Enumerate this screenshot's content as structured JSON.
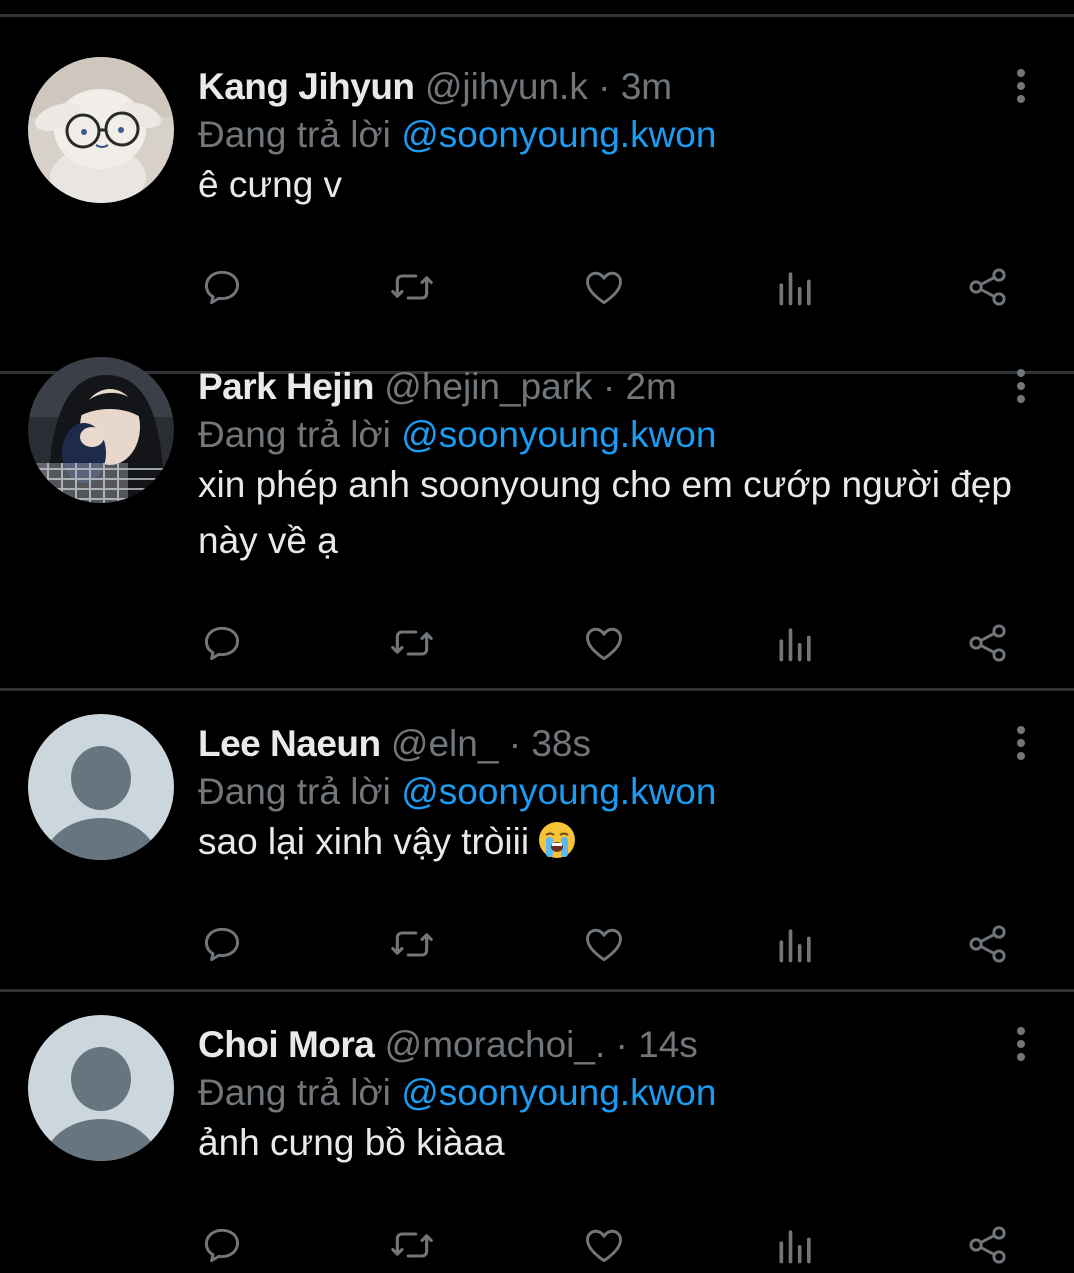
{
  "colors": {
    "background": "#000000",
    "divider": "#2f3336",
    "name": "#e7e9ea",
    "secondary": "#71767b",
    "mention": "#1d9bf0",
    "icon": "#71767b"
  },
  "icons": {
    "reply": "reply-icon",
    "retweet": "retweet-icon",
    "like": "heart-icon",
    "views": "views-icon",
    "share": "share-icon",
    "more": "more-vertical-icon"
  },
  "replies": [
    {
      "name": "Kang Jihyun",
      "handle": "@jihyun.k",
      "dot": "·",
      "time": "3m",
      "replying_prefix": "Đang trả lời",
      "replying_to": "@soonyoung.kwon",
      "text": "ê cưng v",
      "avatar": "plush-toy-with-glasses"
    },
    {
      "name": "Park Hejin",
      "handle": "@hejin_park",
      "dot": "·",
      "time": "2m",
      "replying_prefix": "Đang trả lời",
      "replying_to": "@soonyoung.kwon",
      "text": "xin phép anh soonyoung cho em cướp người đẹp này về ạ",
      "avatar": "girl-photo"
    },
    {
      "name": "Lee Naeun",
      "handle": "@eln_",
      "dot": "·",
      "time": "38s",
      "replying_prefix": "Đang trả lời",
      "replying_to": "@soonyoung.kwon",
      "text": "sao lại xinh vậy tròiii",
      "emoji": "loudly-crying-face",
      "avatar": "default"
    },
    {
      "name": "Choi Mora",
      "handle": "@morachoi_.",
      "dot": "·",
      "time": "14s",
      "replying_prefix": "Đang trả lời",
      "replying_to": "@soonyoung.kwon",
      "text": "ảnh cưng bồ kiàaa",
      "avatar": "default"
    }
  ]
}
